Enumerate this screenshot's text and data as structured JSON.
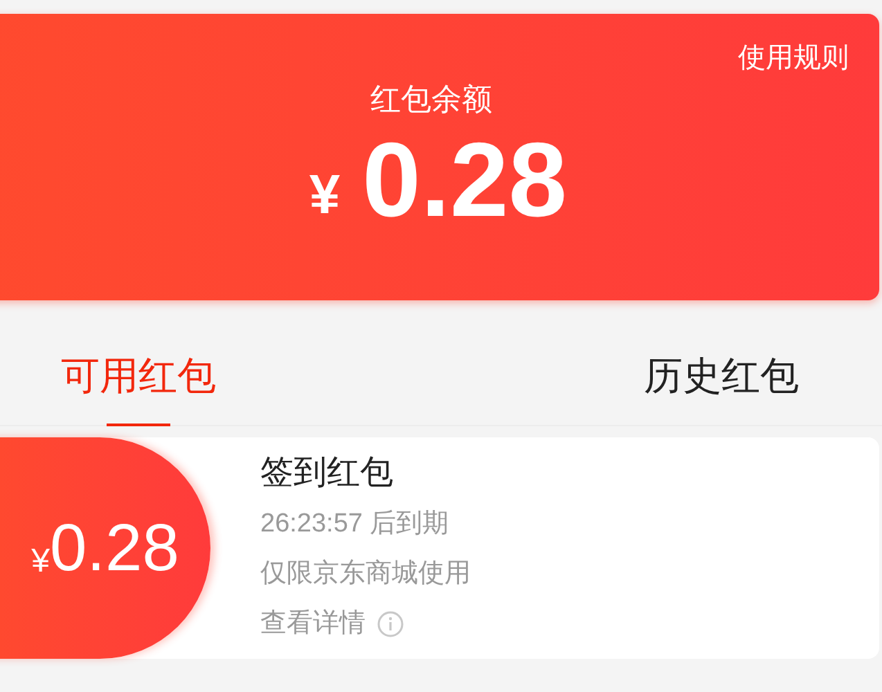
{
  "balance": {
    "rules_link": "使用规则",
    "label": "红包余额",
    "currency": "¥",
    "amount": "0.28"
  },
  "tabs": [
    {
      "label": "可用红包",
      "selected": true
    },
    {
      "label": "历史红包",
      "selected": false
    }
  ],
  "packets": [
    {
      "currency": "¥",
      "amount": "0.28",
      "title": "签到红包",
      "expiry": "26:23:57 后到期",
      "scope": "仅限京东商城使用",
      "details_link": "查看详情"
    }
  ]
}
